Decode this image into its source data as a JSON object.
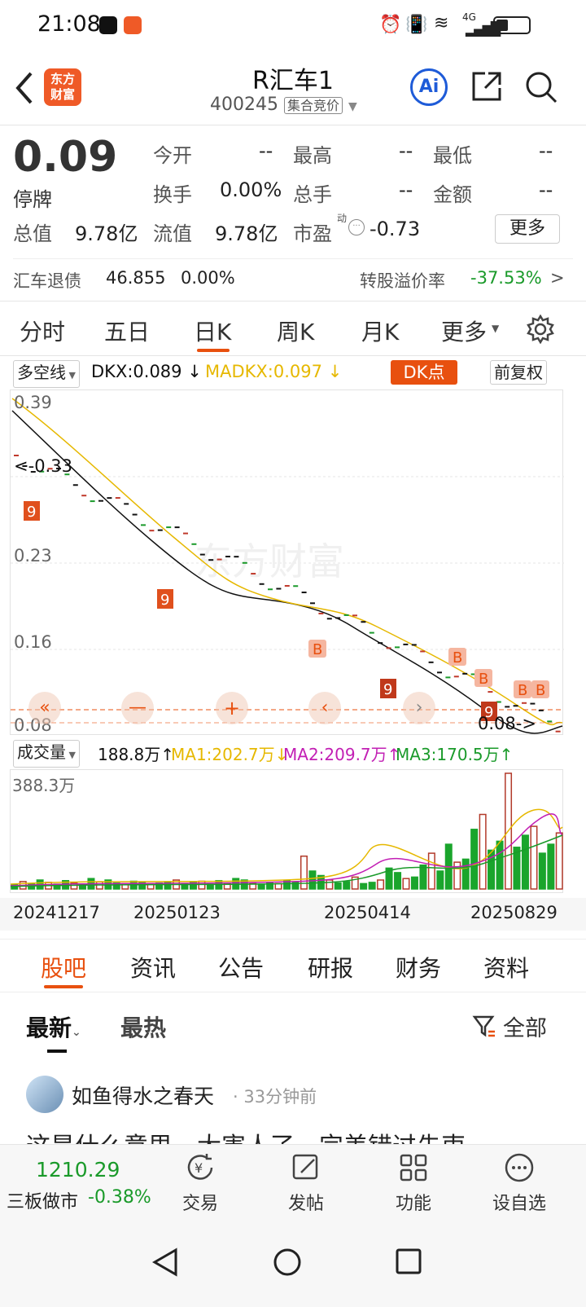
{
  "status_bar": {
    "time": "21:08",
    "network": "4G"
  },
  "header": {
    "logo_text_1": "东方",
    "logo_text_2": "财富",
    "title": "R汇车1",
    "code": "400245",
    "code_tag": "集合竞价",
    "ai_label": "Ai"
  },
  "quote": {
    "price": "0.09",
    "status": "停牌",
    "fields": [
      {
        "label": "今开",
        "value": "--"
      },
      {
        "label": "最高",
        "value": "--"
      },
      {
        "label": "最低",
        "value": "--"
      },
      {
        "label": "换手",
        "value": "0.00%"
      },
      {
        "label": "总手",
        "value": "--"
      },
      {
        "label": "金额",
        "value": "--"
      }
    ],
    "total_value_label": "总值",
    "total_value": "9.78亿",
    "float_value_label": "流值",
    "float_value": "9.78亿",
    "pe_label": "市盈",
    "pe_sup": "动",
    "pe_value": "-0.73",
    "more_button": "更多",
    "bond_name": "汇车退债",
    "bond_price": "46.855",
    "bond_change": "0.00%",
    "premium_label": "转股溢价率",
    "premium_value": "-37.53%",
    "premium_arrow": ">"
  },
  "period_tabs": [
    "分时",
    "五日",
    "日K",
    "周K",
    "月K",
    "更多"
  ],
  "active_tab": "日K",
  "indicator": {
    "name": "多空线",
    "dkx": "DKX:0.089",
    "madkx": "MADKX:0.097",
    "dk_button": "DK点",
    "adjust_button": "前复权"
  },
  "price_chart": {
    "y_labels": [
      "0.39",
      "0.33",
      "0.23",
      "0.16",
      "0.08"
    ],
    "max_label": "0.33",
    "min_label": "0.08",
    "watermark": "东方财富",
    "markers": [
      "B",
      "B",
      "B",
      "B",
      "B"
    ],
    "nine_label": "9"
  },
  "volume": {
    "name": "成交量",
    "vol": "188.8万",
    "ma1": "MA1:202.7万",
    "ma2": "MA2:209.7万",
    "ma3": "MA3:170.5万",
    "max_label": "388.3万",
    "dates": [
      "20241217",
      "20250123",
      "20250414",
      "20250829"
    ]
  },
  "chart_data": {
    "type": "bar",
    "title": "",
    "xlabel": "",
    "ylabel": "",
    "series": [
      {
        "name": "成交量",
        "values": [
          15,
          25,
          18,
          30,
          22,
          16,
          28,
          20,
          14,
          35,
          24,
          30,
          20,
          18,
          26,
          22,
          15,
          20,
          24,
          30,
          18,
          22,
          26,
          15,
          28,
          20,
          35,
          30,
          20,
          16,
          22,
          18,
          28,
          24,
          110,
          60,
          45,
          30,
          20,
          25,
          40,
          18,
          22,
          30,
          70,
          55,
          35,
          40,
          80,
          120,
          60,
          150,
          90,
          100,
          200,
          250,
          130,
          160,
          388,
          140,
          180,
          210,
          120,
          150,
          188
        ]
      }
    ]
  },
  "section_tabs": [
    "股吧",
    "资讯",
    "公告",
    "研报",
    "财务",
    "资料"
  ],
  "active_section": "股吧",
  "feed": {
    "sort_tabs": [
      "最新",
      "最热"
    ],
    "filter_label": "全部",
    "post_user": "如鱼得水之春天",
    "post_time": "33分钟前",
    "post_text": "这是什么意思，大害人了，完美错过先吏"
  },
  "bottom_bar": {
    "index_value": "1210.29",
    "index_name": "三板做市",
    "index_change": "-0.38%",
    "items": [
      "交易",
      "发帖",
      "功能",
      "设自选"
    ]
  },
  "colors": {
    "accent": "#e8500f",
    "green": "#1a9a2a",
    "red": "#c0392b",
    "yellow": "#e6b800"
  }
}
